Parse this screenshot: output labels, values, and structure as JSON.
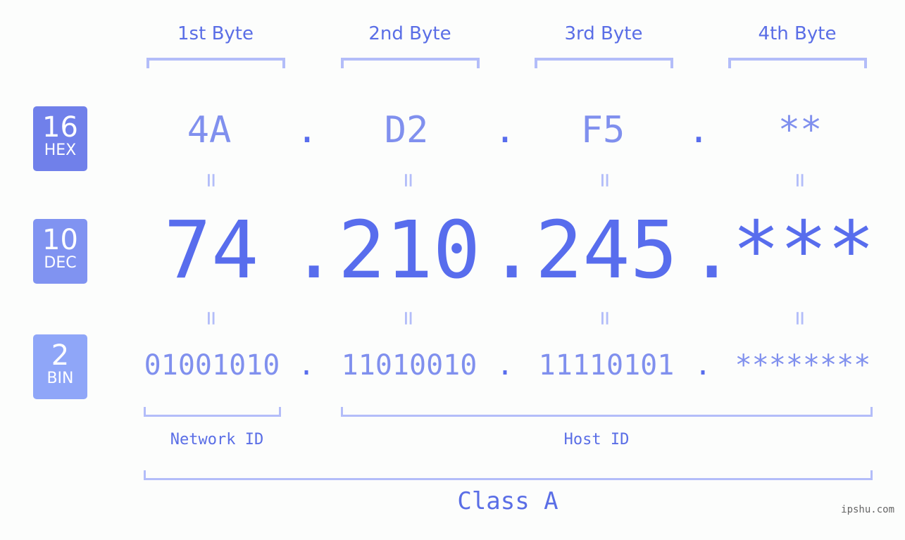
{
  "colors": {
    "hex_box": "#7080ea",
    "dec_box": "#8093f1",
    "bin_box": "#8fa6f8",
    "accent": "#586ded",
    "muted": "#8090ee",
    "bracket": "#b3bdf9",
    "background": "#fcfdfc"
  },
  "bytes": [
    {
      "label": "1st Byte",
      "hex": "4A",
      "dec": "74",
      "bin": "01001010"
    },
    {
      "label": "2nd Byte",
      "hex": "D2",
      "dec": "210",
      "bin": "11010010"
    },
    {
      "label": "3rd Byte",
      "hex": "F5",
      "dec": "245",
      "bin": "11110101"
    },
    {
      "label": "4th Byte",
      "hex": "**",
      "dec": "***",
      "bin": "********"
    }
  ],
  "bases": [
    {
      "num": "16",
      "name": "HEX"
    },
    {
      "num": "10",
      "name": "DEC"
    },
    {
      "num": "2",
      "name": "BIN"
    }
  ],
  "separator": ".",
  "equals": "=",
  "network_label": "Network ID",
  "host_label": "Host ID",
  "class_label": "Class A",
  "watermark": "ipshu.com"
}
